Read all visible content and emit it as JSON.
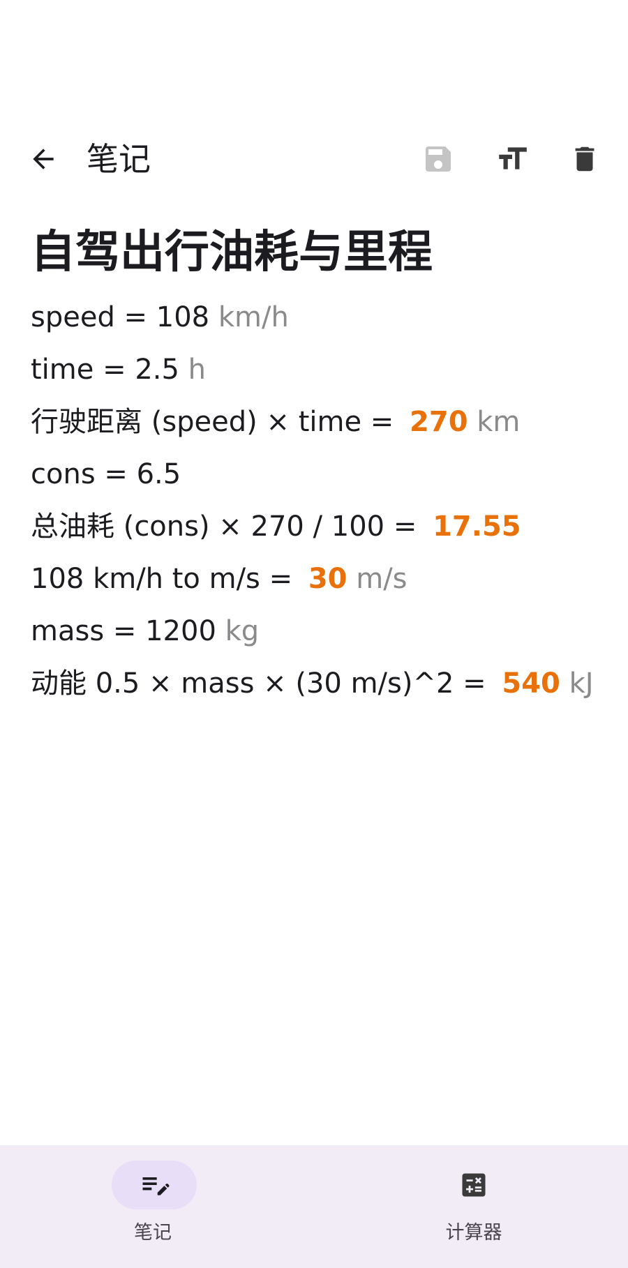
{
  "app_bar": {
    "title": "笔记",
    "icons": [
      "arrow-back-icon",
      "save-icon",
      "text-size-icon",
      "delete-icon"
    ]
  },
  "note": {
    "title": "自驾出行油耗与里程",
    "lines": [
      {
        "text": "speed = 108 ",
        "unit": "km/h",
        "result": ""
      },
      {
        "text": "time = 2.5 ",
        "unit": "h",
        "result": ""
      },
      {
        "text": "行驶距离 (speed) × time = ",
        "result": "270",
        "unit": " km"
      },
      {
        "text": "cons = 6.5",
        "unit": "",
        "result": ""
      },
      {
        "text": "总油耗 (cons) × 270 / 100 = ",
        "result": "17.55",
        "unit": ""
      },
      {
        "text": "108 km/h to m/s = ",
        "result": "30",
        "unit": " m/s"
      },
      {
        "text": "mass = 1200 ",
        "unit": "kg",
        "result": ""
      },
      {
        "text": "动能 0.5 × mass × (30 m/s)^2 = ",
        "result": "540",
        "unit": " kJ"
      }
    ]
  },
  "bottom_nav": {
    "items": [
      {
        "label": "笔记",
        "icon": "edit-note-icon",
        "selected": true
      },
      {
        "label": "计算器",
        "icon": "calculator-icon",
        "selected": false
      }
    ]
  },
  "colors": {
    "result": "#e8710a",
    "unit": "#8a8a8a",
    "nav_background": "#f1ecf6",
    "nav_indicator": "#e8def8"
  }
}
